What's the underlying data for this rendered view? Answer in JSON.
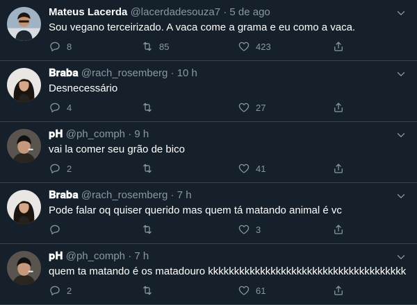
{
  "tweets": [
    {
      "name": "Mateus Lacerda",
      "handle": "@lacerdadesouza7",
      "time": "· 5 de ago",
      "text": "Sou vegano terceirizado. A vaca come a grama e eu como a vaca.",
      "replies": "8",
      "retweets": "85",
      "likes": "423",
      "avatar": "avatar-mateus"
    },
    {
      "name": "𝐁𝐫𝐚𝐛𝐚",
      "handle": "@rach_rosemberg",
      "time": "· 10 h",
      "text": "Desnecessário",
      "replies": "4",
      "retweets": "",
      "likes": "27",
      "avatar": "avatar-braba"
    },
    {
      "name": "𝐩𝐇",
      "handle": "@ph_comph",
      "time": "· 9 h",
      "text": "vai la comer seu grão de bico",
      "replies": "2",
      "retweets": "",
      "likes": "41",
      "avatar": "avatar-ph"
    },
    {
      "name": "𝐁𝐫𝐚𝐛𝐚",
      "handle": "@rach_rosemberg",
      "time": "· 7 h",
      "text": "Pode falar oq quiser querido mas quem tá matando animal é vc",
      "replies": "",
      "retweets": "",
      "likes": "3",
      "avatar": "avatar-braba"
    },
    {
      "name": "𝐩𝐇",
      "handle": "@ph_comph",
      "time": "· 7 h",
      "text": "quem ta matando é os matadouro kkkkkkkkkkkkkkkkkkkkkkkkkkkkkkkkkkkkkk",
      "replies": "2",
      "retweets": "",
      "likes": "61",
      "avatar": "avatar-ph"
    }
  ],
  "colors": {
    "background": "#15202b",
    "divider": "#38444d",
    "secondary_text": "#8899a6"
  },
  "icons": [
    "reply-icon",
    "retweet-icon",
    "like-icon",
    "share-icon",
    "caret-down-icon"
  ]
}
